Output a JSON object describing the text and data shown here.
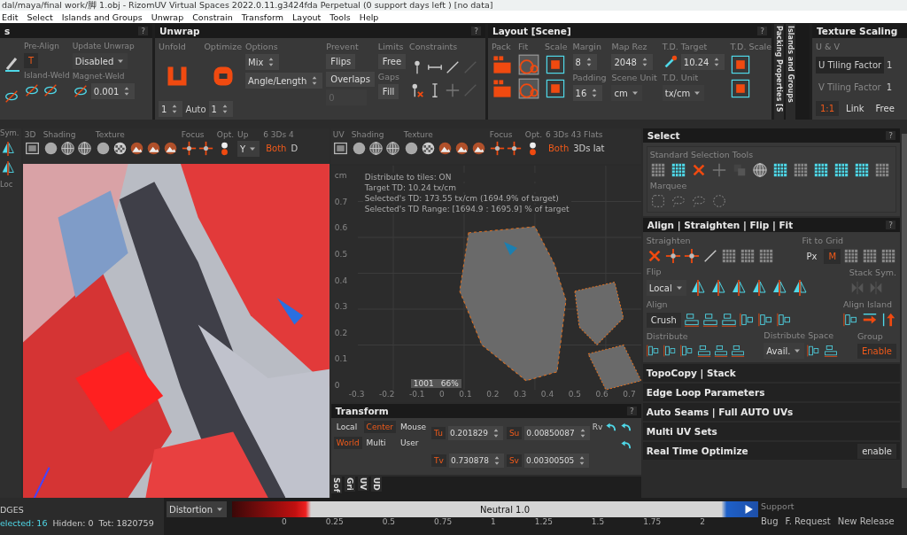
{
  "window": {
    "title": "dal/maya/final work/脚 1.obj - RizomUV  Virtual Spaces 2022.0.11.g3424fda Perpetual  (0 support days left ) [no data]"
  },
  "menu": [
    "Edit",
    "Select",
    "Islands and Groups",
    "Unwrap",
    "Constrain",
    "Transform",
    "Layout",
    "Tools",
    "Help"
  ],
  "left_panel": {
    "title": "s",
    "help": "?",
    "pre_align": {
      "label": "Pre-Align",
      "value": "T"
    },
    "update_unwrap": {
      "label": "Update Unwrap",
      "value": "Disabled"
    },
    "island_weld": "Island-Weld",
    "magnet_weld": {
      "label": "Magnet-Weld",
      "value": "0.001"
    }
  },
  "unwrap": {
    "title": "Unwrap",
    "help": "?",
    "unfold": "Unfold",
    "optimize": "Optimize",
    "unfold_value": "1",
    "auto": "Auto",
    "optimize_value": "1",
    "options_label": "Options",
    "options": [
      "Mix",
      "Angle/Length"
    ],
    "prevent": "Prevent",
    "flips": "Flips",
    "overlaps": "Overlaps",
    "prevent_value": "0",
    "limits": "Limits",
    "free": "Free",
    "gaps": "Gaps",
    "fill": "Fill",
    "constraints": "Constraints"
  },
  "layout": {
    "title": "Layout [Scene]",
    "help": "?",
    "pack": "Pack",
    "fit": "Fit",
    "scale": "Scale",
    "margin": {
      "label": "Margin",
      "value": "8"
    },
    "padding": {
      "label": "Padding",
      "value": "16"
    },
    "map_rez": {
      "label": "Map Rez",
      "value": "2048"
    },
    "scene_unit": {
      "label": "Scene Unit",
      "value": "cm"
    },
    "td_target": {
      "label": "T.D. Target",
      "value": "10.24"
    },
    "td_unit": {
      "label": "T.D. Unit",
      "value": "tx/cm"
    },
    "td_scale": "T.D. Scale"
  },
  "side_tabs": [
    "Packing Properties [S",
    "Islands and Groups"
  ],
  "texture_scaling": {
    "title": "Texture Scaling",
    "uv": "U & V",
    "u_factor": {
      "label": "U Tiling Factor",
      "value": "1"
    },
    "v_factor": {
      "label": "V Tiling Factor",
      "value": "1"
    },
    "buttons": [
      "1:1",
      "Link",
      "Free"
    ]
  },
  "sym": {
    "label": "Sym.",
    "loc": "Loc"
  },
  "view3d": {
    "groups": [
      "3D",
      "Shading",
      "Texture",
      "Focus",
      "Opt.",
      "Up",
      "6 3Ds 4"
    ],
    "up_value": "Y",
    "both": "Both",
    "extra": "D"
  },
  "uv_view": {
    "groups": [
      "UV",
      "Shading",
      "Texture",
      "Focus",
      "Opt.",
      "6 3Ds 43 Flats"
    ],
    "both": "Both",
    "extra": "3Ds lat",
    "unit": "cm",
    "overlay": [
      "Distribute to tiles: ON",
      "Target TD: 10.24 tx/cm",
      "Selected's TD: 173.55 tx/cm (1694.9% of target)",
      "Selected's TD Range: [1694.9 : 1695.9] % of target"
    ],
    "y_ticks": [
      "0.7",
      "0.6",
      "0.5",
      "0.4",
      "0.3",
      "0.2",
      "0.1",
      "0"
    ],
    "x_ticks": [
      "-0.3",
      "-0.2",
      "-0.1",
      "0",
      "0.1",
      "0.2",
      "0.3",
      "0.4",
      "0.5",
      "0.6",
      "0.7"
    ],
    "tile": "1001",
    "zoom": "66%"
  },
  "transform": {
    "title": "Transform",
    "help": "?",
    "modes": [
      {
        "label": "Local",
        "selected": false
      },
      {
        "label": "Center",
        "selected": true
      },
      {
        "label": "Mouse",
        "selected": false
      },
      {
        "label": "World",
        "selected": true
      },
      {
        "label": "Multi",
        "selected": false
      },
      {
        "label": "User",
        "selected": false
      }
    ],
    "fields": [
      {
        "label": "Tu",
        "value": "0.201829"
      },
      {
        "label": "Su",
        "value": "0.00850087"
      },
      {
        "label": "Tv",
        "value": "0.730878"
      },
      {
        "label": "Sv",
        "value": "0.00300505"
      }
    ],
    "rv": "Rv"
  },
  "bottom_tabs": [
    "Sof",
    "Gri",
    "UV",
    "UD"
  ],
  "select": {
    "title": "Select",
    "help": "?",
    "standard": "Standard Selection Tools",
    "marquee": "Marquee"
  },
  "align": {
    "title": "Align | Straighten | Flip | Fit",
    "help": "?",
    "straighten": "Straighten",
    "fit_to_grid": "Fit to Grid",
    "grid_modes": [
      {
        "label": "Px",
        "selected": false
      },
      {
        "label": "M",
        "selected": true
      }
    ],
    "flip": "Flip",
    "flip_mode": "Local",
    "stack_sym": "Stack Sym.",
    "align": "Align",
    "crush": "Crush",
    "align_island": "Align Island",
    "distribute": "Distribute",
    "distribute_space": "Distribute Space",
    "space_mode": "Avail.",
    "group": "Group",
    "group_button": "Enable"
  },
  "collapsed_panels": [
    {
      "title": "TopoCopy | Stack"
    },
    {
      "title": "Edge Loop Parameters"
    },
    {
      "title": "Auto Seams | Full AUTO UVs"
    },
    {
      "title": "Multi UV Sets"
    },
    {
      "title": "Real Time Optimize",
      "button": "enable"
    }
  ],
  "status": {
    "mode": "DGES",
    "selected": "elected: 16",
    "hidden": "Hidden: 0",
    "total": "Tot: 1820759"
  },
  "distortion": {
    "label": "Distortion",
    "center": "Neutral 1.0",
    "ticks": [
      "0",
      "0.25",
      "0.5",
      "0.75",
      "1",
      "1.25",
      "1.5",
      "1.75",
      "2"
    ]
  },
  "support": {
    "title": "Support",
    "links": [
      "Bug",
      "F. Request",
      "New Release"
    ]
  }
}
